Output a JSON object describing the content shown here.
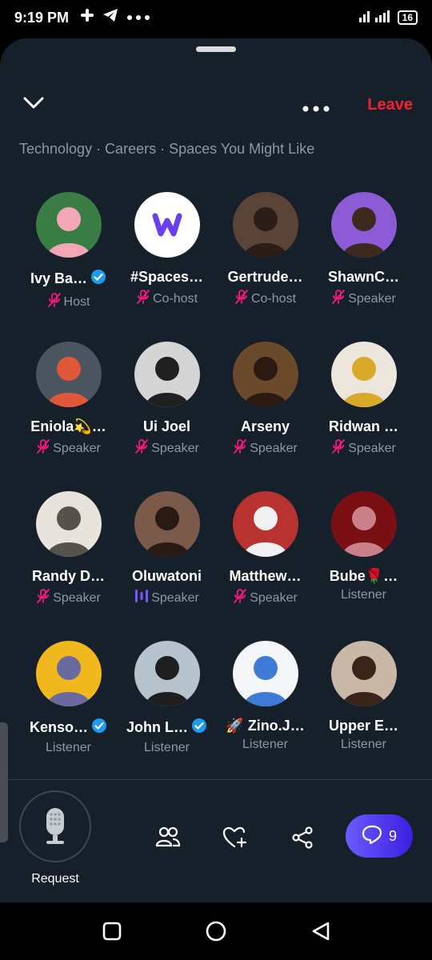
{
  "status": {
    "time": "9:19 PM",
    "battery": "16"
  },
  "header": {
    "leave": "Leave"
  },
  "topics": "Technology · Careers · Spaces You Might Like",
  "participants": [
    {
      "name": "Ivy Ba…",
      "role": "Host",
      "verified": true,
      "mic": "muted",
      "avatar_bg": "#3a7d44",
      "avatar_fg": "#f3a6b6"
    },
    {
      "name": "#Spaces…",
      "role": "Co-host",
      "verified": false,
      "mic": "muted",
      "avatar_bg": "#ffffff",
      "avatar_fg": "#6b3ff0",
      "logo": true
    },
    {
      "name": "Gertrude…",
      "role": "Co-host",
      "verified": false,
      "mic": "muted",
      "avatar_bg": "#5a4438",
      "avatar_fg": "#2b1d17"
    },
    {
      "name": "ShawnC…",
      "role": "Speaker",
      "verified": false,
      "mic": "muted",
      "avatar_bg": "#8e5bd6",
      "avatar_fg": "#3c2a1f"
    },
    {
      "name": "Eniola💫…",
      "role": "Speaker",
      "verified": false,
      "mic": "muted",
      "avatar_bg": "#4a5560",
      "avatar_fg": "#e0573a"
    },
    {
      "name": "Ui Joel",
      "role": "Speaker",
      "verified": false,
      "mic": "muted",
      "avatar_bg": "#d5d5d5",
      "avatar_fg": "#202020"
    },
    {
      "name": "Arseny",
      "role": "Speaker",
      "verified": false,
      "mic": "muted",
      "avatar_bg": "#6b4a2b",
      "avatar_fg": "#2a1a12"
    },
    {
      "name": "Ridwan …",
      "role": "Speaker",
      "verified": false,
      "mic": "muted",
      "avatar_bg": "#ece6dc",
      "avatar_fg": "#d9a92a"
    },
    {
      "name": "Randy D…",
      "role": "Speaker",
      "verified": false,
      "mic": "muted",
      "avatar_bg": "#e8e4dc",
      "avatar_fg": "#55524e"
    },
    {
      "name": "Oluwatoni",
      "role": "Speaker",
      "verified": false,
      "mic": "speaking",
      "avatar_bg": "#7a5a4a",
      "avatar_fg": "#2a1a14"
    },
    {
      "name": "Matthew…",
      "role": "Speaker",
      "verified": false,
      "mic": "muted",
      "avatar_bg": "#b8332f",
      "avatar_fg": "#f1f1f1"
    },
    {
      "name": "Bube🌹…",
      "role": "Listener",
      "verified": false,
      "mic": "none",
      "avatar_bg": "#7a0f14",
      "avatar_fg": "#c98088"
    },
    {
      "name": "Kenso…",
      "role": "Listener",
      "verified": true,
      "mic": "none",
      "avatar_bg": "#f0b81c",
      "avatar_fg": "#6a6aa0"
    },
    {
      "name": "John L…",
      "role": "Listener",
      "verified": true,
      "mic": "none",
      "avatar_bg": "#b7c3cc",
      "avatar_fg": "#1e1e1e"
    },
    {
      "name": "🚀 Zino.J…",
      "role": "Listener",
      "verified": false,
      "mic": "none",
      "avatar_bg": "#f4f6f8",
      "avatar_fg": "#3d7bd6"
    },
    {
      "name": "Upper E…",
      "role": "Listener",
      "verified": false,
      "mic": "none",
      "avatar_bg": "#c9b8a6",
      "avatar_fg": "#3a241a"
    }
  ],
  "footer": {
    "request": "Request",
    "reply_count": "9"
  },
  "colors": {
    "background": "#16202a",
    "leave": "#f4212e",
    "muted_mic": "#f91880",
    "speaking": "#7856ff",
    "muted_text": "#8b98a5"
  }
}
